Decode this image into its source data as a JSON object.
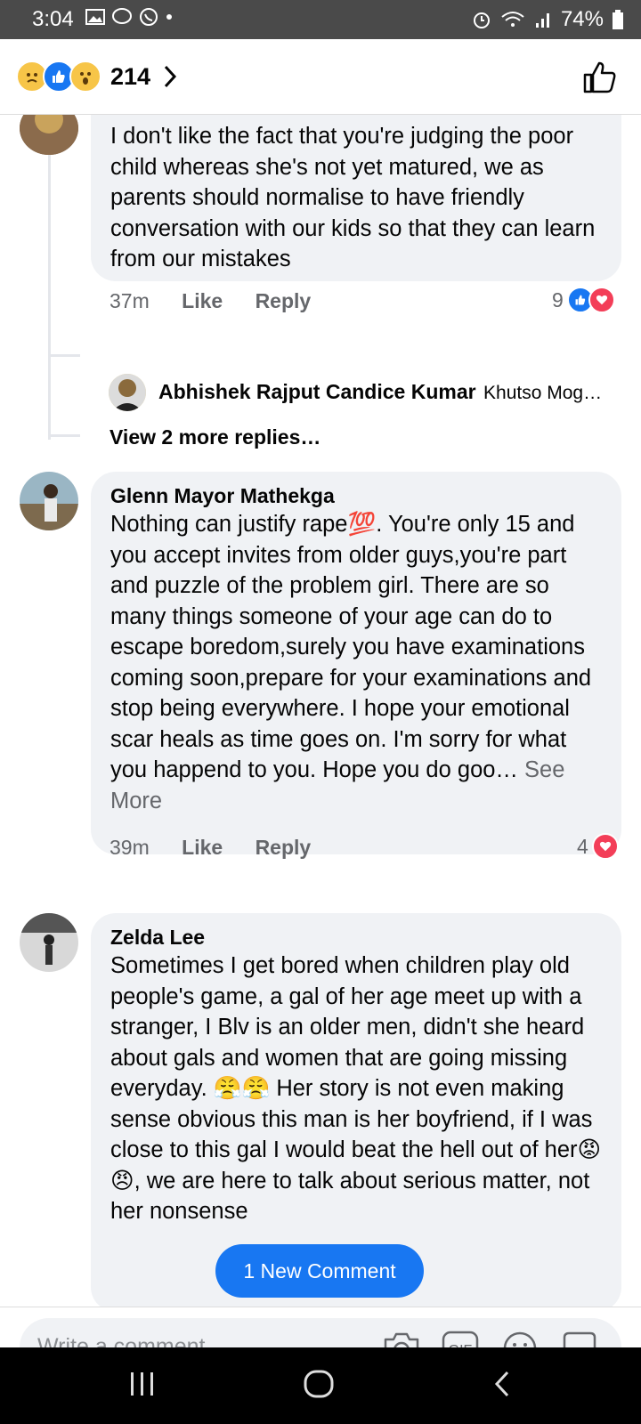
{
  "status_bar": {
    "time": "3:04",
    "battery": "74%"
  },
  "header": {
    "reaction_count": "214"
  },
  "comments": [
    {
      "text": "I don't like the fact that you're judging the poor child whereas she's not yet matured, we as parents should normalise to have friendly conversation with our kids so that they can learn from our mistakes",
      "time": "37m",
      "like": "Like",
      "reply": "Reply",
      "reactions": "9"
    },
    {
      "name": "Glenn Mayor Mathekga",
      "text": "Nothing can justify rape💯. You're only 15 and you accept invites from older guys,you're part and puzzle of the problem girl.  There are so many things someone of your age can do to escape boredom,surely you have examinations coming soon,prepare for your examinations and stop being everywhere. I hope your emotional scar heals as time goes on. I'm sorry for what you happend to you. Hope you do goo…",
      "see_more": "See More",
      "time": "39m",
      "like": "Like",
      "reply": "Reply",
      "reactions": "4"
    },
    {
      "name": "Zelda Lee",
      "text": "Sometimes I get bored when children play old people's game, a gal of her age meet up with a stranger, I Blv is an older men, didn't she heard about gals and women that are going missing everyday. 😤😤 Her story is not even making sense obvious this man is her boyfriend, if I was close to this gal I would beat the hell out of her😡😠, we are here to talk about serious matter, not her nonsense"
    }
  ],
  "reply_preview": {
    "author": "Abhishek Rajput Candice Kumar",
    "snippet": "Khutso Mog…"
  },
  "view_more": "View 2 more replies…",
  "new_comment_pill": "1 New Comment",
  "composer": {
    "placeholder": "Write a comment..."
  }
}
